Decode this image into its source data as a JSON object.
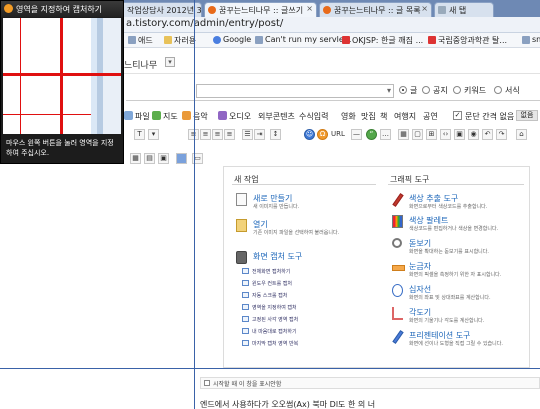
{
  "browser": {
    "tabs": [
      {
        "label": "",
        "active": false
      },
      {
        "label": "작업상담사 2012년 3회",
        "active": false
      },
      {
        "label": "꿈꾸는느티나무 :: 글쓰기",
        "active": true
      },
      {
        "label": "꿈꾸는느티나무 :: 글 목록",
        "active": false
      },
      {
        "label": "새 탭",
        "active": false
      }
    ],
    "url": "a.tistory.com/admin/entry/post/",
    "bookmarks": [
      "애드",
      "자러용",
      "Google",
      "Can't run my servle...",
      "OKJSP: 한글 깨짐 ...",
      "국립중앙과학관 탈...",
      "sno"
    ]
  },
  "blog": {
    "name": "느티나무",
    "category_radios": [
      "글",
      "공지",
      "키워드",
      "서식"
    ],
    "toolbar1": [
      "파일",
      "지도",
      "음악",
      "오디오",
      "외부콘텐츠",
      "수식입력",
      "영화",
      "맛집",
      "책",
      "여행지",
      "공연",
      "문단 간격 없음",
      "없음"
    ],
    "toolbar2_url": "URL"
  },
  "capture_panel": {
    "left_title": "새 작업",
    "right_title": "그래픽 도구",
    "left_items": [
      {
        "title": "새로 만들기",
        "desc": "새 이미지를 만듭니다.",
        "icon": "new-document-icon"
      },
      {
        "title": "열기",
        "desc": "기존 이미지 파일을 선택하여 불러옵니다.",
        "icon": "folder-icon"
      },
      {
        "title": "화면 캡처 도구",
        "desc": "",
        "icon": "camera-icon"
      }
    ],
    "capture_subitems": [
      "전체화면 캡처하기",
      "윈도우 컨트롤 캡처",
      "자동 스크롤 캡처",
      "영역을 지정하여 캡처",
      "고정된 사각 영역 캡처",
      "내 마음대로 캡처하기",
      "마지막 캡처 영역 반복"
    ],
    "right_items": [
      {
        "title": "색상 추출 도구",
        "desc": "화면으로부터 색상코드를 추출합니다.",
        "icon": "color-picker-icon"
      },
      {
        "title": "색상 팔레트",
        "desc": "색상코드를 편집하거나 색상을 변경합니다.",
        "icon": "palette-icon"
      },
      {
        "title": "돋보기",
        "desc": "화면을 확대하는 돋보기를 표시합니다.",
        "icon": "magnifier-icon"
      },
      {
        "title": "눈금자",
        "desc": "화면의 픽셀을 측정하기 위한 자 표시합니다.",
        "icon": "ruler-icon"
      },
      {
        "title": "십자선",
        "desc": "화면의 좌표 및 상대좌표를 계산합니다.",
        "icon": "crosshair-icon"
      },
      {
        "title": "각도기",
        "desc": "화면의 기울기나 각도를 계산합니다.",
        "icon": "protractor-icon"
      },
      {
        "title": "프리젠테이션 도구",
        "desc": "화면에 선이나 도형을 직접 그릴 수 있습니다.",
        "icon": "pen-icon"
      }
    ],
    "footer_checkbox": "시작할 때 이 창을 표시안함"
  },
  "bottom_text": "엔드에서 사용하다가 오오썸(Ax) 북마 Dl도 한 의 너",
  "zoom_overlay": {
    "title": "영역을 지정하여 캡처하기",
    "help": "마우스 왼쪽 버튼을 눌러 영역을 지정하여 주십시오."
  },
  "colors": {
    "accent": "#1a64b8",
    "crosshair": "#e01010",
    "guide": "#3a62a8",
    "tabstrip": "#6e89b4"
  }
}
